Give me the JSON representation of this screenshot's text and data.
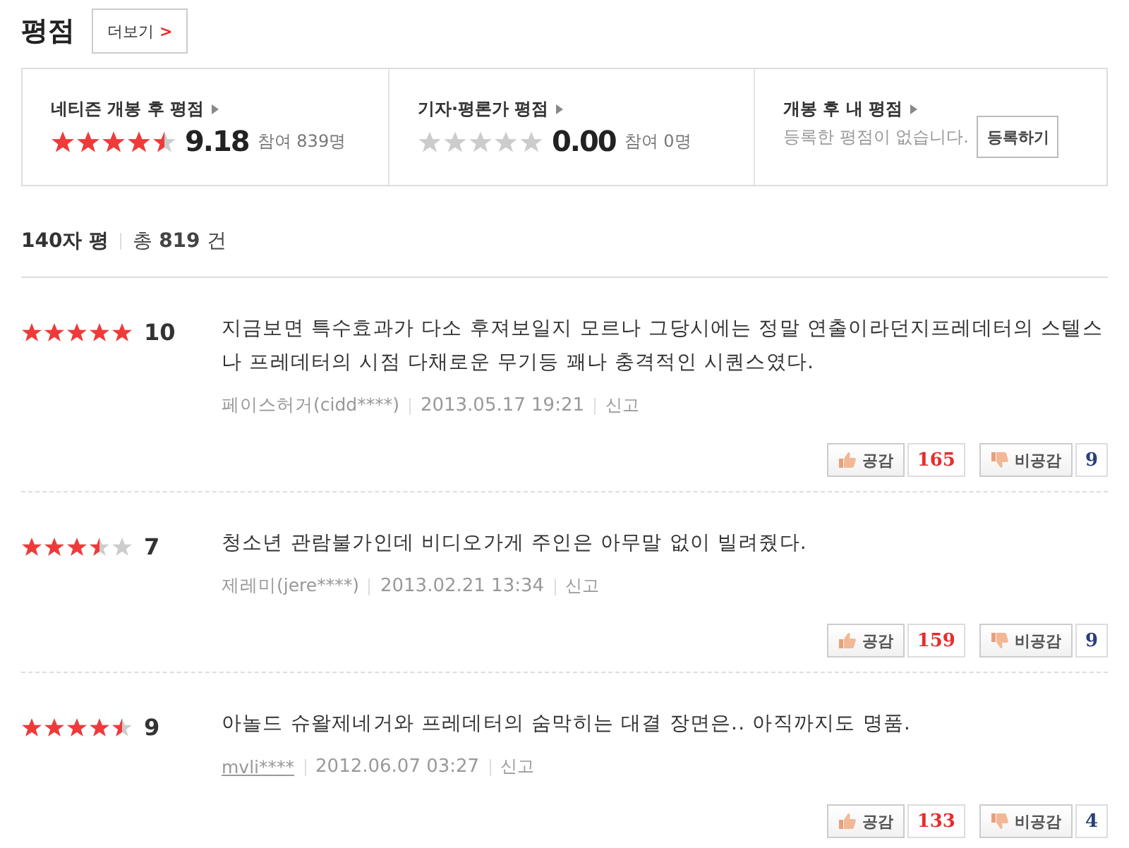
{
  "header": {
    "title": "평점",
    "more_button": "더보기",
    "more_arrow": ">"
  },
  "summary": [
    {
      "kind": "score",
      "title": "네티즌 개봉 후 평점",
      "stars": 4.5,
      "score": "9.18",
      "participants": "참여 839명"
    },
    {
      "kind": "score",
      "title": "기자·평론가 평점",
      "stars": 0,
      "score": "0.00",
      "participants": "참여 0명"
    },
    {
      "kind": "mine",
      "title": "개봉 후 내 평점",
      "message": "등록한 평점이 없습니다.",
      "button": "등록하기"
    }
  ],
  "list_header": {
    "label": "140자 평",
    "total_prefix": "총",
    "total_count": "819",
    "total_suffix": "건"
  },
  "reviews": [
    {
      "stars": 5,
      "score": "10",
      "text": "지금보면 특수효과가 다소 후져보일지 모르나 그당시에는 정말 연출이라던지프레데터의 스텔스나 프레데터의 시점 다채로운 무기등 꽤나 충격적인 시퀀스였다.",
      "author": "페이스허거(cidd****)",
      "author_link": false,
      "date": "2013.05.17 19:21",
      "report": "신고",
      "like_label": "공감",
      "likes": "165",
      "dislike_label": "비공감",
      "dislikes": "9"
    },
    {
      "stars": 3.5,
      "score": "7",
      "text": "청소년 관람불가인데 비디오가게 주인은 아무말 없이 빌려줬다.",
      "author": "제레미(jere****)",
      "author_link": false,
      "date": "2013.02.21 13:34",
      "report": "신고",
      "like_label": "공감",
      "likes": "159",
      "dislike_label": "비공감",
      "dislikes": "9"
    },
    {
      "stars": 4.5,
      "score": "9",
      "text": "아놀드 슈왈제네거와 프레데터의 숨막히는 대결 장면은.. 아직까지도 명품.",
      "author": "mvli****",
      "author_link": true,
      "date": "2012.06.07 03:27",
      "report": "신고",
      "like_label": "공감",
      "likes": "133",
      "dislike_label": "비공감",
      "dislikes": "4"
    }
  ]
}
